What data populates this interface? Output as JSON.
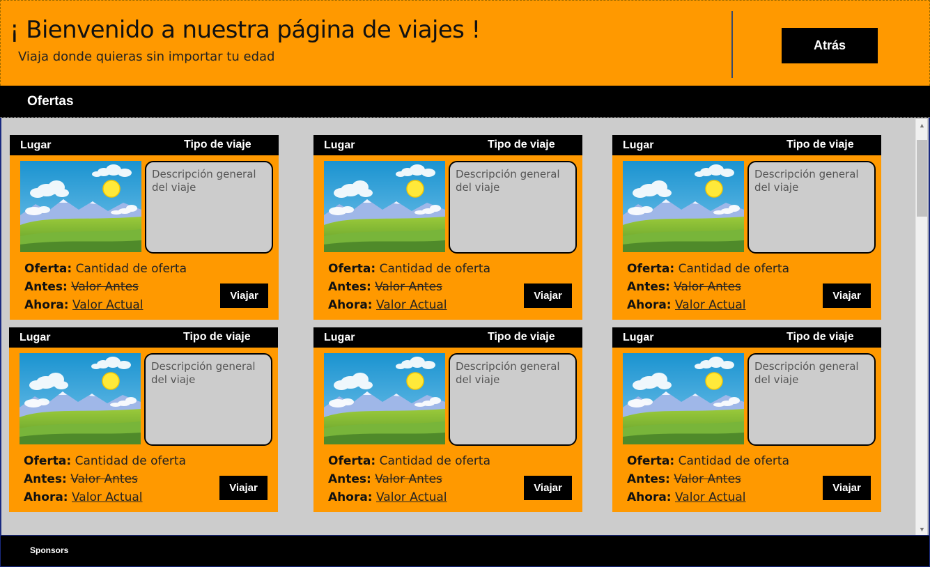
{
  "header": {
    "title": "¡ Bienvenido a nuestra página de viajes !",
    "subtitle": "Viaja donde quieras sin importar tu edad",
    "back_label": "Atrás"
  },
  "nav": {
    "label": "Ofertas"
  },
  "cards": [
    {
      "place": "Lugar",
      "trip_type": "Tipo de viaje",
      "description": "Descripción general del viaje",
      "offer_label": "Oferta:",
      "offer_value": "Cantidad de oferta",
      "before_label": "Antes:",
      "before_value": "Valor Antes",
      "now_label": "Ahora:",
      "now_value": "Valor Actual",
      "button": "Viajar"
    },
    {
      "place": "Lugar",
      "trip_type": "Tipo de viaje",
      "description": "Descripción general del viaje",
      "offer_label": "Oferta:",
      "offer_value": "Cantidad de oferta",
      "before_label": "Antes:",
      "before_value": "Valor Antes",
      "now_label": "Ahora:",
      "now_value": "Valor Actual",
      "button": "Viajar"
    },
    {
      "place": "Lugar",
      "trip_type": "Tipo de viaje",
      "description": "Descripción general del viaje",
      "offer_label": "Oferta:",
      "offer_value": "Cantidad de oferta",
      "before_label": "Antes:",
      "before_value": "Valor Antes",
      "now_label": "Ahora:",
      "now_value": "Valor Actual",
      "button": "Viajar"
    },
    {
      "place": "Lugar",
      "trip_type": "Tipo de viaje",
      "description": "Descripción general del viaje",
      "offer_label": "Oferta:",
      "offer_value": "Cantidad de oferta",
      "before_label": "Antes:",
      "before_value": "Valor Antes",
      "now_label": "Ahora:",
      "now_value": "Valor Actual",
      "button": "Viajar"
    },
    {
      "place": "Lugar",
      "trip_type": "Tipo de viaje",
      "description": "Descripción general del viaje",
      "offer_label": "Oferta:",
      "offer_value": "Cantidad de oferta",
      "before_label": "Antes:",
      "before_value": "Valor Antes",
      "now_label": "Ahora:",
      "now_value": "Valor Actual",
      "button": "Viajar"
    },
    {
      "place": "Lugar",
      "trip_type": "Tipo de viaje",
      "description": "Descripción general del viaje",
      "offer_label": "Oferta:",
      "offer_value": "Cantidad de oferta",
      "before_label": "Antes:",
      "before_value": "Valor Antes",
      "now_label": "Ahora:",
      "now_value": "Valor Actual",
      "button": "Viajar"
    }
  ],
  "footer": {
    "label": "Sponsors"
  },
  "colors": {
    "accent": "#ff9900",
    "bar": "#000000",
    "content_bg": "#cccccc"
  },
  "icons": {
    "scroll_up": "chevron-up-icon",
    "scroll_down": "chevron-down-icon",
    "landscape": "landscape-image"
  }
}
